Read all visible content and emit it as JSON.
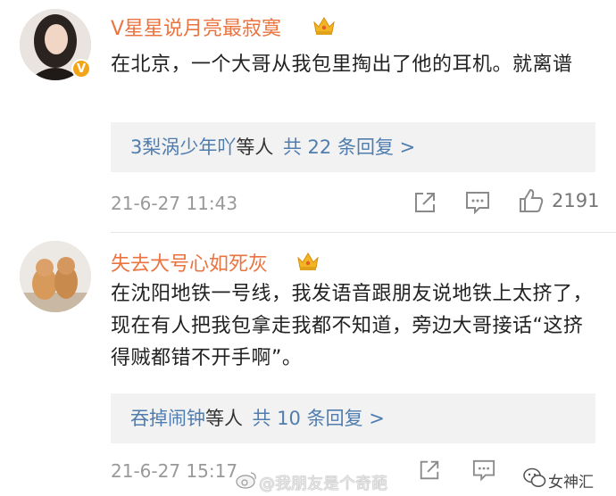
{
  "comments": [
    {
      "username": "V星星说月亮最寂寞",
      "verified_badge": "V",
      "text": "在北京，一个大哥从我包里掏出了他的耳机。就离谱",
      "replies": {
        "users": "3梨涡少年吖",
        "mid": "等人",
        "count_text": "共 22 条回复 >"
      },
      "timestamp": "21-6-27 11:43",
      "likes": "2191"
    },
    {
      "username": "失去大号心如死灰",
      "text": "在沈阳地铁一号线，我发语音跟朋友说地铁上太挤了，现在有人把我包拿走我都不知道，旁边大哥接话“这挤得贼都错不开手啊”。",
      "replies": {
        "users": "吞掉闹钟",
        "mid": "等人",
        "count_text": "共 10 条回复 >"
      },
      "timestamp": "21-6-27 15:17"
    }
  ],
  "watermarks": {
    "weibo": "@我朋友是个奇葩",
    "wechat": "女神汇"
  },
  "colors": {
    "username": "#eb7340",
    "link": "#507daf",
    "reply_bg": "#f2f2f2",
    "meta": "#999999"
  },
  "icons": [
    "crown-icon",
    "share-icon",
    "comment-icon",
    "like-icon",
    "weibo-logo-icon",
    "wechat-logo-icon"
  ]
}
